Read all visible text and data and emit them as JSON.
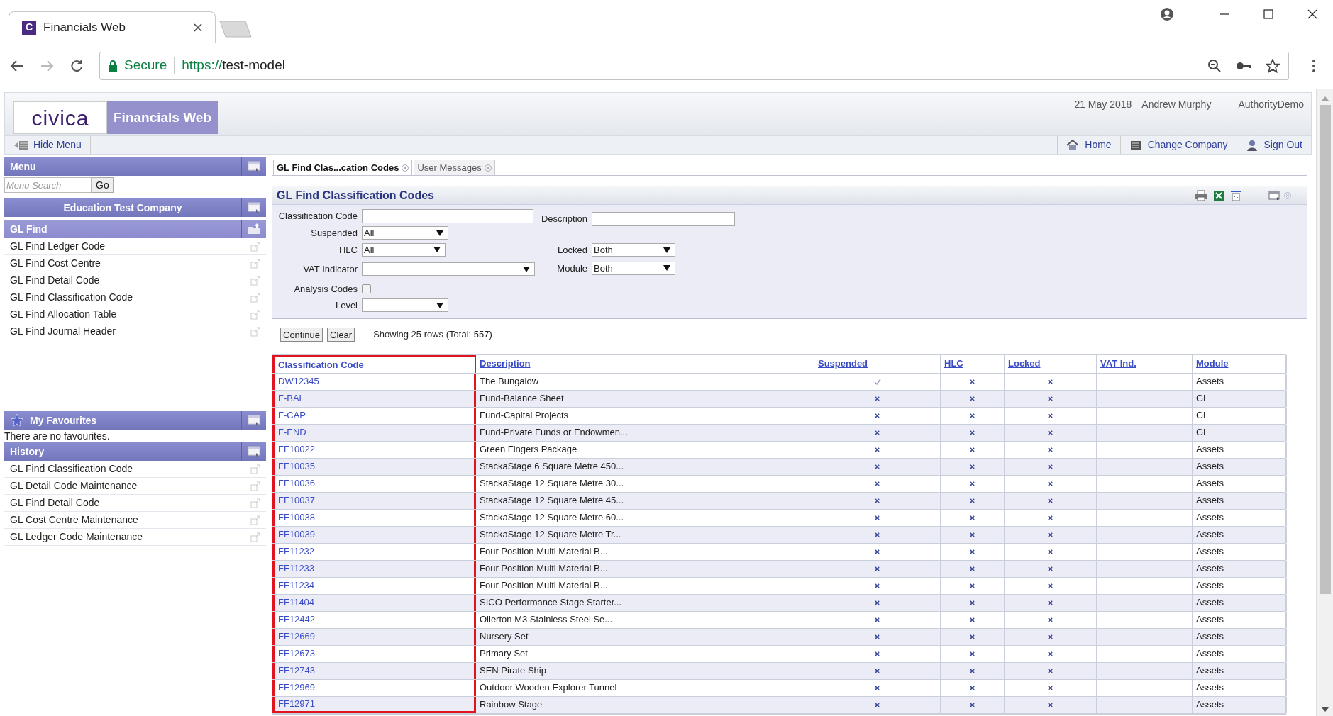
{
  "browser": {
    "tab": {
      "favicon_letter": "C",
      "title": "Financials Web"
    },
    "security": "Secure",
    "url_scheme": "https://",
    "url_host": "test-model"
  },
  "header": {
    "logo": "civica",
    "product": "Financials Web",
    "date": "21 May 2018",
    "user": "Andrew Murphy",
    "company": "AuthorityDemo"
  },
  "navbar": {
    "hide_menu": "Hide Menu",
    "links": [
      {
        "kind": "home",
        "label": "Home"
      },
      {
        "kind": "company",
        "label": "Change Company"
      },
      {
        "kind": "signout",
        "label": "Sign Out"
      }
    ]
  },
  "sidebar": {
    "menu": {
      "title": "Menu",
      "search_placeholder": "Menu Search",
      "go": "Go"
    },
    "company": "Education Test Company",
    "section": {
      "title": "GL Find",
      "items": [
        "GL Find Ledger Code",
        "GL Find Cost Centre",
        "GL Find Detail Code",
        "GL Find Classification Code",
        "GL Find Allocation Table",
        "GL Find Journal Header"
      ]
    },
    "favourites": {
      "title": "My Favourites",
      "empty": "There are no favourites."
    },
    "history": {
      "title": "History",
      "items": [
        "GL Find Classification Code",
        "GL Detail Code Maintenance",
        "GL Find Detail Code",
        "GL Cost Centre Maintenance",
        "GL Ledger Code Maintenance"
      ]
    }
  },
  "tabs": [
    {
      "label": "GL Find Clas...cation Codes",
      "selected": true
    },
    {
      "label": "User Messages",
      "selected": false
    }
  ],
  "panel": {
    "title": "GL Find Classification Codes",
    "fields": {
      "classification_code": {
        "label": "Classification Code"
      },
      "description": {
        "label": "Description"
      },
      "suspended": {
        "label": "Suspended",
        "value": "All"
      },
      "hlc": {
        "label": "HLC",
        "value": "All"
      },
      "locked": {
        "label": "Locked",
        "value": "Both"
      },
      "vat_indicator": {
        "label": "VAT Indicator"
      },
      "module": {
        "label": "Module",
        "value": "Both"
      },
      "analysis_codes": {
        "label": "Analysis Codes",
        "checked": false
      },
      "level": {
        "label": "Level"
      }
    }
  },
  "actions": {
    "continue": "Continue",
    "clear": "Clear",
    "summary": "Showing 25 rows (Total: 557)"
  },
  "table": {
    "columns": [
      {
        "label": "Classification Code",
        "highlighted": true
      },
      {
        "label": "Description",
        "highlighted": false
      },
      {
        "label": "Suspended",
        "highlighted": false
      },
      {
        "label": "HLC",
        "highlighted": false
      },
      {
        "label": "Locked",
        "highlighted": false
      },
      {
        "label": "VAT Ind.",
        "highlighted": false
      },
      {
        "label": "Module",
        "highlighted": false
      }
    ],
    "rows": [
      {
        "code": "DW12345",
        "description": "The Bungalow",
        "suspended": true,
        "hlc": false,
        "locked": false,
        "module": "Assets"
      },
      {
        "code": "F-BAL",
        "description": "Fund-Balance Sheet",
        "suspended": false,
        "hlc": false,
        "locked": false,
        "module": "GL"
      },
      {
        "code": "F-CAP",
        "description": "Fund-Capital Projects",
        "suspended": false,
        "hlc": false,
        "locked": false,
        "module": "GL"
      },
      {
        "code": "F-END",
        "description": "Fund-Private Funds or Endowmen...",
        "suspended": false,
        "hlc": false,
        "locked": false,
        "module": "GL"
      },
      {
        "code": "FF10022",
        "description": "Green Fingers Package",
        "suspended": false,
        "hlc": false,
        "locked": false,
        "module": "Assets"
      },
      {
        "code": "FF10035",
        "description": "StackaStage 6 Square Metre 450...",
        "suspended": false,
        "hlc": false,
        "locked": false,
        "module": "Assets"
      },
      {
        "code": "FF10036",
        "description": "StackaStage 12 Square Metre 30...",
        "suspended": false,
        "hlc": false,
        "locked": false,
        "module": "Assets"
      },
      {
        "code": "FF10037",
        "description": "StackaStage 12 Square Metre 45...",
        "suspended": false,
        "hlc": false,
        "locked": false,
        "module": "Assets"
      },
      {
        "code": "FF10038",
        "description": "StackaStage 12 Square Metre 60...",
        "suspended": false,
        "hlc": false,
        "locked": false,
        "module": "Assets"
      },
      {
        "code": "FF10039",
        "description": "StackaStage 12 Square Metre Tr...",
        "suspended": false,
        "hlc": false,
        "locked": false,
        "module": "Assets"
      },
      {
        "code": "FF11232",
        "description": "Four Position Multi Material B...",
        "suspended": false,
        "hlc": false,
        "locked": false,
        "module": "Assets"
      },
      {
        "code": "FF11233",
        "description": "Four Position Multi Material B...",
        "suspended": false,
        "hlc": false,
        "locked": false,
        "module": "Assets"
      },
      {
        "code": "FF11234",
        "description": "Four Position Multi Material B...",
        "suspended": false,
        "hlc": false,
        "locked": false,
        "module": "Assets"
      },
      {
        "code": "FF11404",
        "description": "SICO Performance Stage Starter...",
        "suspended": false,
        "hlc": false,
        "locked": false,
        "module": "Assets"
      },
      {
        "code": "FF12442",
        "description": "Ollerton M3 Stainless Steel Se...",
        "suspended": false,
        "hlc": false,
        "locked": false,
        "module": "Assets"
      },
      {
        "code": "FF12669",
        "description": "Nursery Set",
        "suspended": false,
        "hlc": false,
        "locked": false,
        "module": "Assets"
      },
      {
        "code": "FF12673",
        "description": "Primary Set",
        "suspended": false,
        "hlc": false,
        "locked": false,
        "module": "Assets"
      },
      {
        "code": "FF12743",
        "description": "SEN Pirate Ship",
        "suspended": false,
        "hlc": false,
        "locked": false,
        "module": "Assets"
      },
      {
        "code": "FF12969",
        "description": "Outdoor Wooden Explorer Tunnel",
        "suspended": false,
        "hlc": false,
        "locked": false,
        "module": "Assets"
      },
      {
        "code": "FF12971",
        "description": "Rainbow Stage",
        "suspended": false,
        "hlc": false,
        "locked": false,
        "module": "Assets"
      }
    ]
  }
}
